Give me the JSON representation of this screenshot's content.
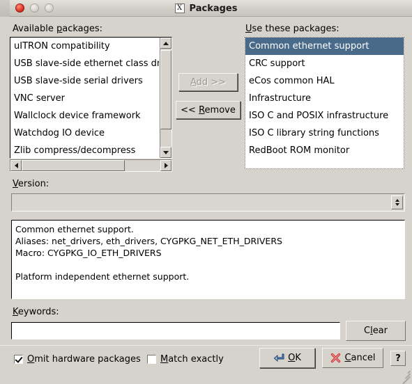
{
  "window": {
    "title": "Packages",
    "app_icon": "x11-window-icon",
    "controls": [
      "close-button",
      "minimize-button",
      "maximize-button"
    ]
  },
  "available": {
    "label": "Available packages:",
    "label_mnemonic": "p",
    "items": [
      "uITRON compatibility",
      "USB slave-side ethernet class drivers",
      "USB slave-side serial drivers",
      "VNC server",
      "Wallclock device framework",
      "Watchdog IO device",
      "Zlib compress/decompress"
    ],
    "selected_index": -1
  },
  "transfer": {
    "add_label": "Add >>",
    "add_mnemonic": "A",
    "add_enabled": false,
    "remove_label": "<< Remove",
    "remove_mnemonic": "R",
    "remove_enabled": true
  },
  "used": {
    "label": "Use these packages:",
    "label_mnemonic": "U",
    "items": [
      "Common ethernet support",
      "CRC support",
      "eCos common HAL",
      "Infrastructure",
      "ISO C and POSIX infrastructure",
      "ISO C library string functions",
      "RedBoot ROM monitor"
    ],
    "selected_index": 0,
    "selection_color": "#4a6a8a",
    "selection_text_color": "#ffffff"
  },
  "version": {
    "label": "Version:",
    "label_mnemonic": "V",
    "value": "",
    "placeholder": ""
  },
  "description": {
    "text": "Common ethernet support.\nAliases: net_drivers, eth_drivers, CYGPKG_NET_ETH_DRIVERS\nMacro: CYGPKG_IO_ETH_DRIVERS\n\nPlatform independent ethernet support."
  },
  "keywords": {
    "label": "Keywords:",
    "label_mnemonic": "K",
    "value": "",
    "placeholder": "",
    "clear_label": "Clear",
    "clear_mnemonic": "l"
  },
  "options": [
    {
      "label": "Omit hardware packages",
      "mnemonic": "O",
      "checked": true
    },
    {
      "label": "Match exactly",
      "mnemonic": "M",
      "checked": false
    }
  ],
  "actions": {
    "ok_label": "OK",
    "ok_mnemonic": "O",
    "ok_icon": "blue-return-arrow-icon",
    "cancel_label": "Cancel",
    "cancel_mnemonic": "C",
    "cancel_icon": "red-x-icon",
    "help_label": "?"
  },
  "scrollbars": {
    "available_vertical": {
      "thumb_start_pct": 2,
      "thumb_size_pct": 80
    },
    "available_horizontal": {
      "thumb_start_pct": 0,
      "thumb_size_pct": 74
    }
  },
  "colors": {
    "window_bg": "#d6d3cc",
    "field_bg": "#ffffff",
    "accent": "#4a6a8a",
    "close_button": "#e23b28"
  }
}
